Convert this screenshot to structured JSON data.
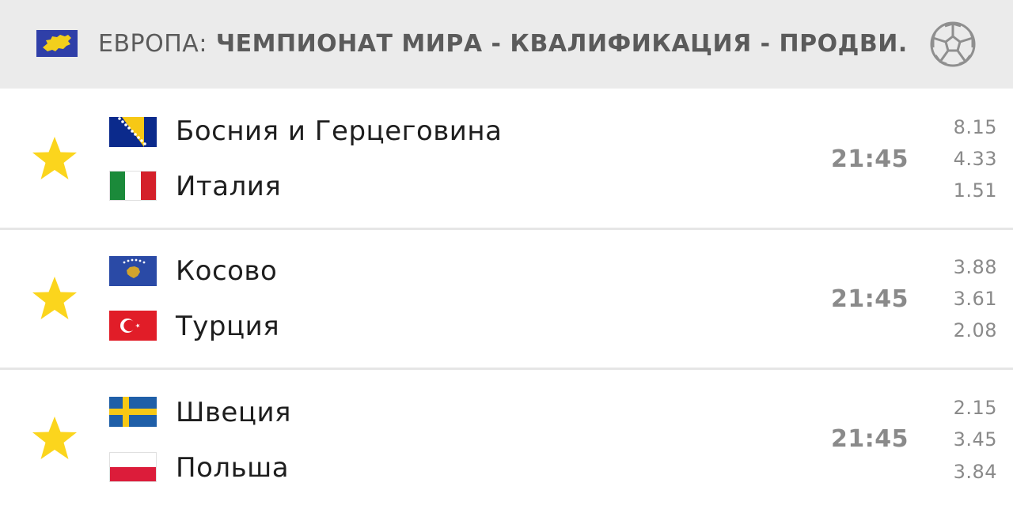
{
  "header": {
    "region": "ЕВРОПА",
    "separator": ":",
    "league_name": " ЧЕМПИОНАТ МИРА - КВАЛИФИКАЦИЯ - ПРОДВИ...",
    "flag_icon": "europe-flag-icon",
    "sport_icon": "soccer-ball-icon"
  },
  "colors": {
    "header_bg": "#ebebeb",
    "star": "#fbd51d",
    "time": "#8a8a8a",
    "team_text": "#1e1e1e"
  },
  "matches": [
    {
      "favorite_icon": "star-icon",
      "home": {
        "name": "Босния и Герцеговина",
        "flag": "bosnia-flag-icon"
      },
      "away": {
        "name": "Италия",
        "flag": "italy-flag-icon"
      },
      "time": "21:45",
      "odds": [
        "8.15",
        "4.33",
        "1.51"
      ]
    },
    {
      "favorite_icon": "star-icon",
      "home": {
        "name": "Косово",
        "flag": "kosovo-flag-icon"
      },
      "away": {
        "name": "Турция",
        "flag": "turkey-flag-icon"
      },
      "time": "21:45",
      "odds": [
        "3.88",
        "3.61",
        "2.08"
      ]
    },
    {
      "favorite_icon": "star-icon",
      "home": {
        "name": "Швеция",
        "flag": "sweden-flag-icon"
      },
      "away": {
        "name": "Польша",
        "flag": "poland-flag-icon"
      },
      "time": "21:45",
      "odds": [
        "2.15",
        "3.45",
        "3.84"
      ]
    }
  ]
}
